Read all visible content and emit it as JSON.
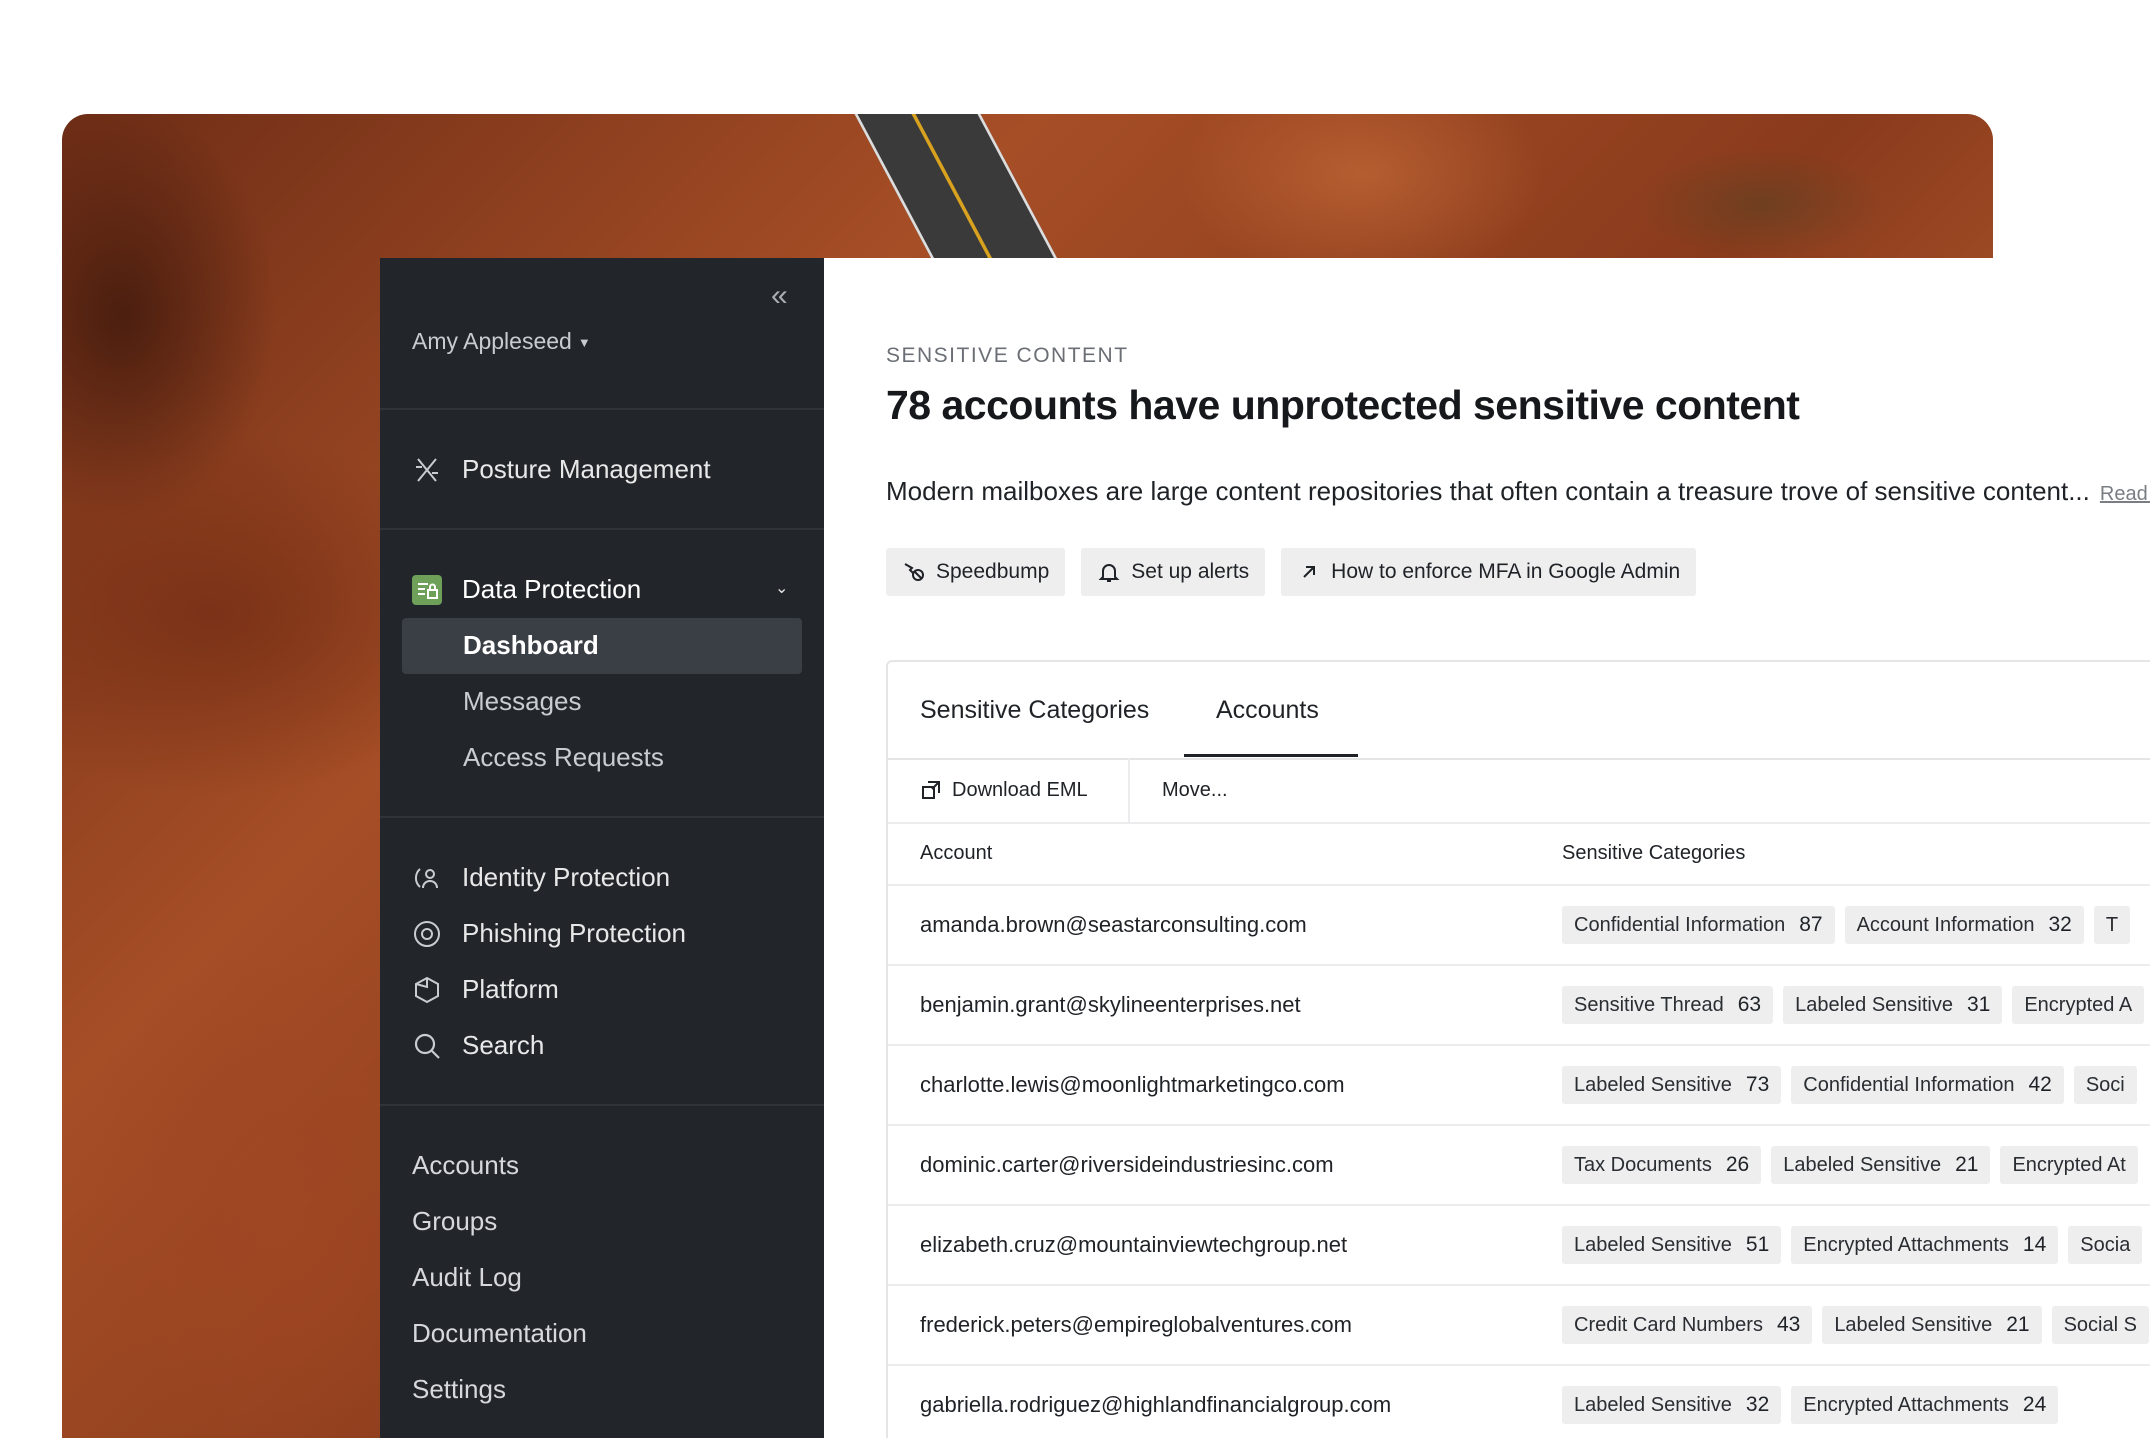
{
  "sidebar": {
    "user_name": "Amy Appleseed",
    "posture": "Posture Management",
    "data_protection": "Data Protection",
    "sub_items": [
      "Dashboard",
      "Messages",
      "Access Requests"
    ],
    "security_items": [
      "Identity Protection",
      "Phishing Protection",
      "Platform",
      "Search"
    ],
    "admin_items": [
      "Accounts",
      "Groups",
      "Audit Log",
      "Documentation",
      "Settings"
    ]
  },
  "main": {
    "eyebrow": "SENSITIVE CONTENT",
    "headline": "78 accounts have unprotected sensitive content",
    "description": "Modern mailboxes are large content repositories that often contain a treasure trove of sensitive content...",
    "read_more": "Read m",
    "chips": [
      "Speedbump",
      "Set up alerts",
      "How to enforce MFA in Google Admin"
    ],
    "tabs": [
      "Sensitive Categories",
      "Accounts"
    ],
    "active_tab": "Accounts",
    "toolbar": {
      "download": "Download EML",
      "move": "Move..."
    },
    "columns": [
      "Account",
      "Sensitive Categories"
    ],
    "rows": [
      {
        "account": "amanda.brown@seastarconsulting.com",
        "tags": [
          [
            "Confidential Information",
            "87"
          ],
          [
            "Account Information",
            "32"
          ],
          [
            "T",
            ""
          ]
        ]
      },
      {
        "account": "benjamin.grant@skylineenterprises.net",
        "tags": [
          [
            "Sensitive Thread",
            "63"
          ],
          [
            "Labeled Sensitive",
            "31"
          ],
          [
            "Encrypted A",
            ""
          ]
        ]
      },
      {
        "account": "charlotte.lewis@moonlightmarketingco.com",
        "tags": [
          [
            "Labeled Sensitive",
            "73"
          ],
          [
            "Confidential Information",
            "42"
          ],
          [
            "Soci",
            ""
          ]
        ]
      },
      {
        "account": "dominic.carter@riversideindustriesinc.com",
        "tags": [
          [
            "Tax Documents",
            "26"
          ],
          [
            "Labeled Sensitive",
            "21"
          ],
          [
            "Encrypted At",
            ""
          ]
        ]
      },
      {
        "account": "elizabeth.cruz@mountainviewtechgroup.net",
        "tags": [
          [
            "Labeled Sensitive",
            "51"
          ],
          [
            "Encrypted Attachments",
            "14"
          ],
          [
            "Socia",
            ""
          ]
        ]
      },
      {
        "account": "frederick.peters@empireglobalventures.com",
        "tags": [
          [
            "Credit Card Numbers",
            "43"
          ],
          [
            "Labeled Sensitive",
            "21"
          ],
          [
            "Social S",
            ""
          ]
        ]
      },
      {
        "account": "gabriella.rodriguez@highlandfinancialgroup.com",
        "tags": [
          [
            "Labeled Sensitive",
            "32"
          ],
          [
            "Encrypted Attachments",
            "24"
          ]
        ]
      }
    ]
  },
  "colors": {
    "sidebar_bg": "#22262b",
    "data_protection_icon": "#6ea05a",
    "chip_bg": "#eeeeef"
  },
  "icons": [
    "collapse-icon",
    "posture-icon",
    "data-protection-icon",
    "chevron-down-icon",
    "identity-icon",
    "phishing-icon",
    "platform-icon",
    "search-icon",
    "speedbump-icon",
    "bell-icon",
    "external-arrow-icon",
    "download-icon"
  ]
}
